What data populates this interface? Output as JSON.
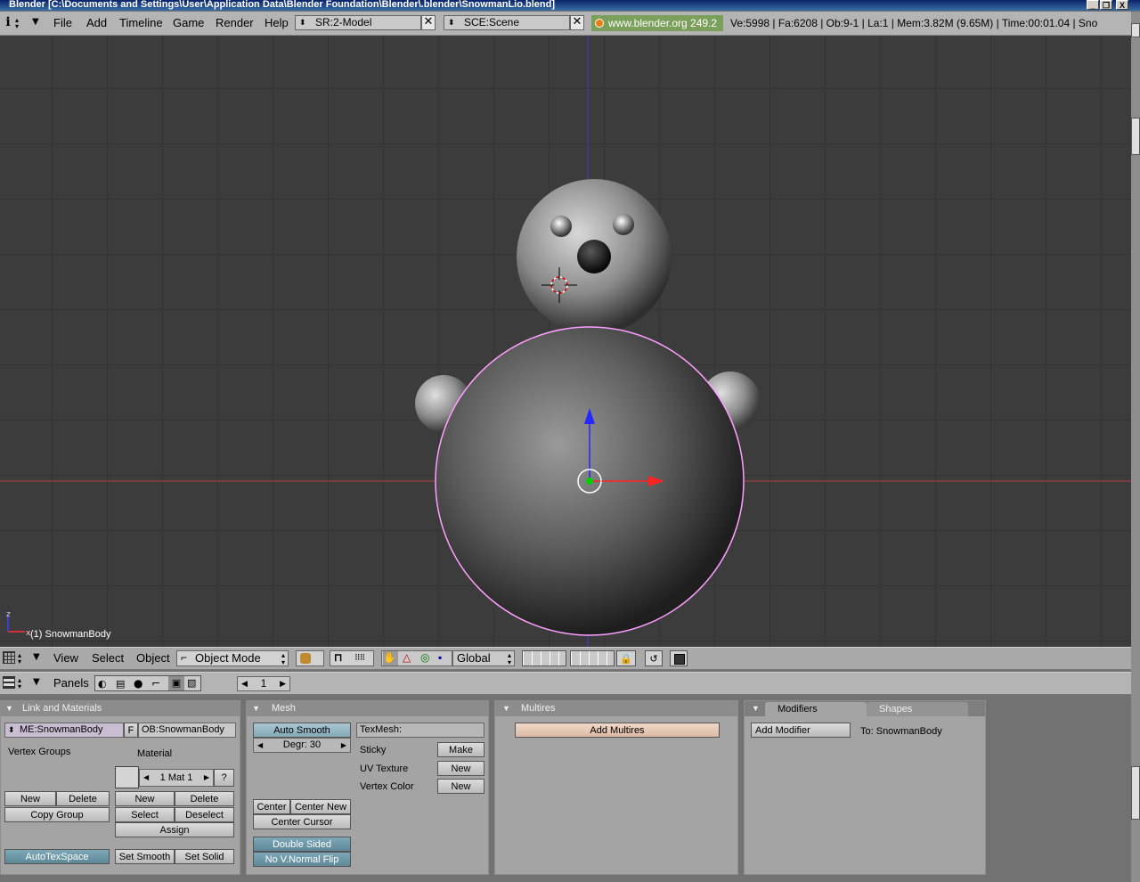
{
  "window": {
    "title": "Blender [C:\\Documents and Settings\\User\\Application Data\\Blender Foundation\\Blender\\.blender\\SnowmanLio.blend]",
    "min": "_",
    "max": "❐",
    "close": "X"
  },
  "menu": {
    "info_icon": "i",
    "items": [
      "File",
      "Add",
      "Timeline",
      "Game",
      "Render",
      "Help"
    ],
    "screen": "SR:2-Model",
    "scene": "SCE:Scene",
    "website": "www.blender.org 249.2",
    "stats": "Ve:5998 | Fa:6208 | Ob:9-1 | La:1  | Mem:3.82M (9.65M)  | Time:00:01.04 | Sno"
  },
  "viewport": {
    "object_label": "(1) SnowmanBody",
    "axis_z": "z",
    "axis_x": "x"
  },
  "header3d": {
    "view": "View",
    "select": "Select",
    "object": "Object",
    "mode": "Object Mode",
    "orientation": "Global"
  },
  "buttonsHeader": {
    "panels": "Panels",
    "frame": "1"
  },
  "panels": {
    "link": {
      "title": "Link and Materials",
      "mesh_name": "ME:SnowmanBody",
      "fake_user": "F",
      "object_name": "OB:SnowmanBody",
      "vertex_groups": "Vertex Groups",
      "material": "Material",
      "mat_index": "1 Mat 1",
      "help": "?",
      "vg_new": "New",
      "vg_delete": "Delete",
      "copy_group": "Copy Group",
      "m_new": "New",
      "m_delete": "Delete",
      "m_select": "Select",
      "m_deselect": "Deselect",
      "m_assign": "Assign",
      "autotexspace": "AutoTexSpace",
      "set_smooth": "Set Smooth",
      "set_solid": "Set Solid"
    },
    "mesh": {
      "title": "Mesh",
      "auto_smooth": "Auto Smooth",
      "degr": "Degr: 30",
      "texmesh": "TexMesh:",
      "sticky": "Sticky",
      "sticky_btn": "Make",
      "uv": "UV Texture",
      "uv_btn": "New",
      "vcol": "Vertex Color",
      "vcol_btn": "New",
      "center": "Center",
      "center_new": "Center New",
      "center_cursor": "Center Cursor",
      "double_sided": "Double Sided",
      "no_vnormal_flip": "No V.Normal Flip"
    },
    "multires": {
      "title": "Multires",
      "add": "Add Multires"
    },
    "modifiers": {
      "tab1": "Modifiers",
      "tab2": "Shapes",
      "add": "Add Modifier",
      "to": "To: SnowmanBody"
    }
  },
  "colors": {
    "accent_blue": "#0a246a",
    "active_button": "#6f97a7",
    "web_chip": "#7ba05b",
    "selection_outline": "#ff9fff"
  }
}
